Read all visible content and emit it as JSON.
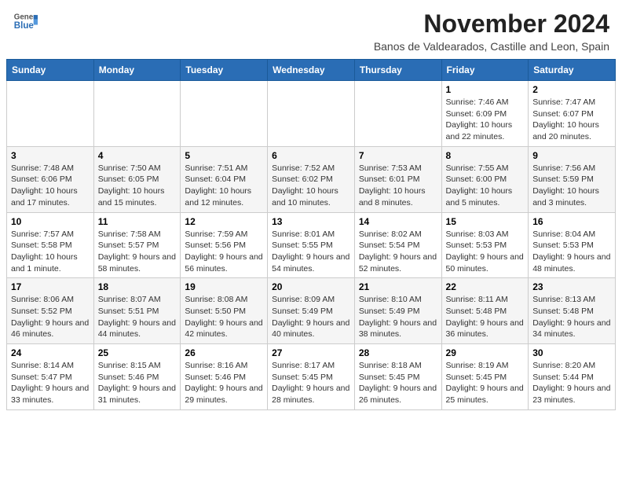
{
  "header": {
    "logo_line1": "General",
    "logo_line2": "Blue",
    "month_title": "November 2024",
    "location": "Banos de Valdearados, Castille and Leon, Spain"
  },
  "weekdays": [
    "Sunday",
    "Monday",
    "Tuesday",
    "Wednesday",
    "Thursday",
    "Friday",
    "Saturday"
  ],
  "weeks": [
    [
      {
        "day": "",
        "info": ""
      },
      {
        "day": "",
        "info": ""
      },
      {
        "day": "",
        "info": ""
      },
      {
        "day": "",
        "info": ""
      },
      {
        "day": "",
        "info": ""
      },
      {
        "day": "1",
        "info": "Sunrise: 7:46 AM\nSunset: 6:09 PM\nDaylight: 10 hours and 22 minutes."
      },
      {
        "day": "2",
        "info": "Sunrise: 7:47 AM\nSunset: 6:07 PM\nDaylight: 10 hours and 20 minutes."
      }
    ],
    [
      {
        "day": "3",
        "info": "Sunrise: 7:48 AM\nSunset: 6:06 PM\nDaylight: 10 hours and 17 minutes."
      },
      {
        "day": "4",
        "info": "Sunrise: 7:50 AM\nSunset: 6:05 PM\nDaylight: 10 hours and 15 minutes."
      },
      {
        "day": "5",
        "info": "Sunrise: 7:51 AM\nSunset: 6:04 PM\nDaylight: 10 hours and 12 minutes."
      },
      {
        "day": "6",
        "info": "Sunrise: 7:52 AM\nSunset: 6:02 PM\nDaylight: 10 hours and 10 minutes."
      },
      {
        "day": "7",
        "info": "Sunrise: 7:53 AM\nSunset: 6:01 PM\nDaylight: 10 hours and 8 minutes."
      },
      {
        "day": "8",
        "info": "Sunrise: 7:55 AM\nSunset: 6:00 PM\nDaylight: 10 hours and 5 minutes."
      },
      {
        "day": "9",
        "info": "Sunrise: 7:56 AM\nSunset: 5:59 PM\nDaylight: 10 hours and 3 minutes."
      }
    ],
    [
      {
        "day": "10",
        "info": "Sunrise: 7:57 AM\nSunset: 5:58 PM\nDaylight: 10 hours and 1 minute."
      },
      {
        "day": "11",
        "info": "Sunrise: 7:58 AM\nSunset: 5:57 PM\nDaylight: 9 hours and 58 minutes."
      },
      {
        "day": "12",
        "info": "Sunrise: 7:59 AM\nSunset: 5:56 PM\nDaylight: 9 hours and 56 minutes."
      },
      {
        "day": "13",
        "info": "Sunrise: 8:01 AM\nSunset: 5:55 PM\nDaylight: 9 hours and 54 minutes."
      },
      {
        "day": "14",
        "info": "Sunrise: 8:02 AM\nSunset: 5:54 PM\nDaylight: 9 hours and 52 minutes."
      },
      {
        "day": "15",
        "info": "Sunrise: 8:03 AM\nSunset: 5:53 PM\nDaylight: 9 hours and 50 minutes."
      },
      {
        "day": "16",
        "info": "Sunrise: 8:04 AM\nSunset: 5:53 PM\nDaylight: 9 hours and 48 minutes."
      }
    ],
    [
      {
        "day": "17",
        "info": "Sunrise: 8:06 AM\nSunset: 5:52 PM\nDaylight: 9 hours and 46 minutes."
      },
      {
        "day": "18",
        "info": "Sunrise: 8:07 AM\nSunset: 5:51 PM\nDaylight: 9 hours and 44 minutes."
      },
      {
        "day": "19",
        "info": "Sunrise: 8:08 AM\nSunset: 5:50 PM\nDaylight: 9 hours and 42 minutes."
      },
      {
        "day": "20",
        "info": "Sunrise: 8:09 AM\nSunset: 5:49 PM\nDaylight: 9 hours and 40 minutes."
      },
      {
        "day": "21",
        "info": "Sunrise: 8:10 AM\nSunset: 5:49 PM\nDaylight: 9 hours and 38 minutes."
      },
      {
        "day": "22",
        "info": "Sunrise: 8:11 AM\nSunset: 5:48 PM\nDaylight: 9 hours and 36 minutes."
      },
      {
        "day": "23",
        "info": "Sunrise: 8:13 AM\nSunset: 5:48 PM\nDaylight: 9 hours and 34 minutes."
      }
    ],
    [
      {
        "day": "24",
        "info": "Sunrise: 8:14 AM\nSunset: 5:47 PM\nDaylight: 9 hours and 33 minutes."
      },
      {
        "day": "25",
        "info": "Sunrise: 8:15 AM\nSunset: 5:46 PM\nDaylight: 9 hours and 31 minutes."
      },
      {
        "day": "26",
        "info": "Sunrise: 8:16 AM\nSunset: 5:46 PM\nDaylight: 9 hours and 29 minutes."
      },
      {
        "day": "27",
        "info": "Sunrise: 8:17 AM\nSunset: 5:45 PM\nDaylight: 9 hours and 28 minutes."
      },
      {
        "day": "28",
        "info": "Sunrise: 8:18 AM\nSunset: 5:45 PM\nDaylight: 9 hours and 26 minutes."
      },
      {
        "day": "29",
        "info": "Sunrise: 8:19 AM\nSunset: 5:45 PM\nDaylight: 9 hours and 25 minutes."
      },
      {
        "day": "30",
        "info": "Sunrise: 8:20 AM\nSunset: 5:44 PM\nDaylight: 9 hours and 23 minutes."
      }
    ]
  ]
}
